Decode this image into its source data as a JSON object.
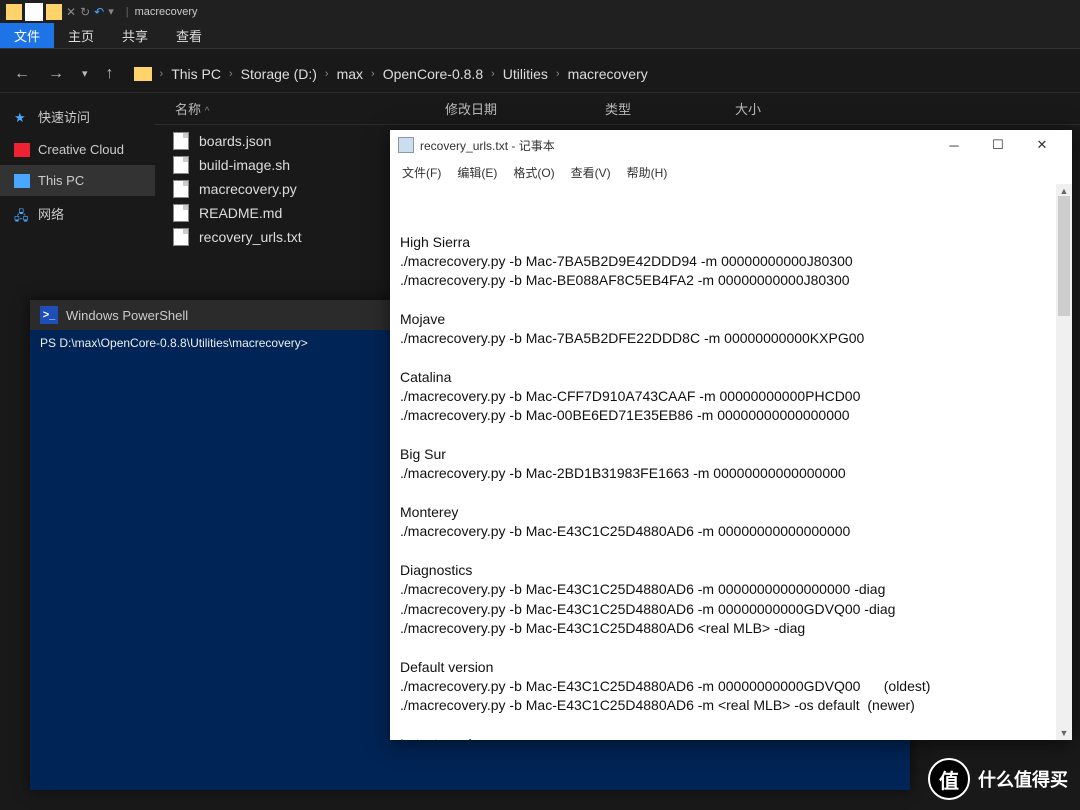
{
  "titlebar": {
    "window_title": "macrecovery"
  },
  "ribbon": {
    "tabs": {
      "file": "文件",
      "home": "主页",
      "share": "共享",
      "view": "查看"
    }
  },
  "breadcrumb": {
    "items": [
      "This PC",
      "Storage (D:)",
      "max",
      "OpenCore-0.8.8",
      "Utilities",
      "macrecovery"
    ]
  },
  "columns": {
    "name": "名称",
    "modified": "修改日期",
    "type": "类型",
    "size": "大小"
  },
  "sidebar": {
    "items": [
      {
        "label": "快速访问"
      },
      {
        "label": "Creative Cloud"
      },
      {
        "label": "This PC"
      },
      {
        "label": "网络"
      }
    ]
  },
  "files": [
    {
      "name": "boards.json"
    },
    {
      "name": "build-image.sh"
    },
    {
      "name": "macrecovery.py"
    },
    {
      "name": "README.md"
    },
    {
      "name": "recovery_urls.txt"
    }
  ],
  "powershell": {
    "title": "Windows PowerShell",
    "prompt": "PS D:\\max\\OpenCore-0.8.8\\Utilities\\macrecovery>"
  },
  "notepad": {
    "title": "recovery_urls.txt - 记事本",
    "menu": {
      "file": "文件(F)",
      "edit": "编辑(E)",
      "format": "格式(O)",
      "view": "查看(V)",
      "help": "帮助(H)"
    },
    "content": "High Sierra\n./macrecovery.py -b Mac-7BA5B2D9E42DDD94 -m 00000000000J80300\n./macrecovery.py -b Mac-BE088AF8C5EB4FA2 -m 00000000000J80300\n\nMojave\n./macrecovery.py -b Mac-7BA5B2DFE22DDD8C -m 00000000000KXPG00\n\nCatalina\n./macrecovery.py -b Mac-CFF7D910A743CAAF -m 00000000000PHCD00\n./macrecovery.py -b Mac-00BE6ED71E35EB86 -m 00000000000000000\n\nBig Sur\n./macrecovery.py -b Mac-2BD1B31983FE1663 -m 00000000000000000\n\nMonterey\n./macrecovery.py -b Mac-E43C1C25D4880AD6 -m 00000000000000000\n\nDiagnostics\n./macrecovery.py -b Mac-E43C1C25D4880AD6 -m 00000000000000000 -diag\n./macrecovery.py -b Mac-E43C1C25D4880AD6 -m 00000000000GDVQ00 -diag\n./macrecovery.py -b Mac-E43C1C25D4880AD6 <real MLB> -diag\n\nDefault version\n./macrecovery.py -b Mac-E43C1C25D4880AD6 -m 00000000000GDVQ00      (oldest)\n./macrecovery.py -b Mac-E43C1C25D4880AD6 -m <real MLB> -os default  (newer)\n\nLatest version"
  },
  "logo": {
    "char": "值",
    "text": "什么值得买"
  }
}
